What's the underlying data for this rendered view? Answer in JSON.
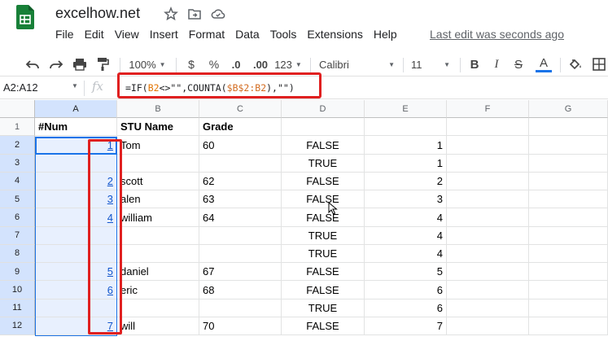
{
  "app": {
    "doc_title": "excelhow.net",
    "last_edit": "Last edit was seconds ago",
    "brand_green": "#188038"
  },
  "menu": [
    "File",
    "Edit",
    "View",
    "Insert",
    "Format",
    "Data",
    "Tools",
    "Extensions",
    "Help"
  ],
  "toolbar": {
    "zoom": "100%",
    "currency": "$",
    "percent": "%",
    "decrease_decimal": ".0",
    "increase_decimal": ".00",
    "more_formats": "123",
    "font": "Calibri",
    "font_size": "11",
    "bold": "B",
    "italic": "I",
    "strikethrough": "S",
    "text_color": "A",
    "text_color_bar": "#1a73e8"
  },
  "formula_bar": {
    "name_box": "A2:A12",
    "fx": "fx",
    "formula_parts": [
      "=IF(",
      "B2",
      "<>\"\",COUNTA(",
      "$B$2:B2",
      "),\"\")"
    ]
  },
  "columns": [
    "A",
    "B",
    "C",
    "D",
    "E",
    "F",
    "G"
  ],
  "rows": [
    {
      "n": "1",
      "A": "#Num",
      "B": "STU Name",
      "C": "Grade",
      "D": "",
      "E": ""
    },
    {
      "n": "2",
      "A": "1",
      "B": "Tom",
      "C": "60",
      "D": "FALSE",
      "E": "1"
    },
    {
      "n": "3",
      "A": "",
      "B": "",
      "C": "",
      "D": "TRUE",
      "E": "1"
    },
    {
      "n": "4",
      "A": "2",
      "B": "scott",
      "C": "62",
      "D": "FALSE",
      "E": "2"
    },
    {
      "n": "5",
      "A": "3",
      "B": "alen",
      "C": "63",
      "D": "FALSE",
      "E": "3"
    },
    {
      "n": "6",
      "A": "4",
      "B": "william",
      "C": "64",
      "D": "FALSE",
      "E": "4"
    },
    {
      "n": "7",
      "A": "",
      "B": "",
      "C": "",
      "D": "TRUE",
      "E": "4"
    },
    {
      "n": "8",
      "A": "",
      "B": "",
      "C": "",
      "D": "TRUE",
      "E": "4"
    },
    {
      "n": "9",
      "A": "5",
      "B": "daniel",
      "C": "67",
      "D": "FALSE",
      "E": "5"
    },
    {
      "n": "10",
      "A": "6",
      "B": "eric",
      "C": "68",
      "D": "FALSE",
      "E": "6"
    },
    {
      "n": "11",
      "A": "",
      "B": "",
      "C": "",
      "D": "TRUE",
      "E": "6"
    },
    {
      "n": "12",
      "A": "7",
      "B": "will",
      "C": "70",
      "D": "FALSE",
      "E": "7"
    }
  ],
  "highlight_color": "#e02020",
  "selection_color": "#1a73e8"
}
